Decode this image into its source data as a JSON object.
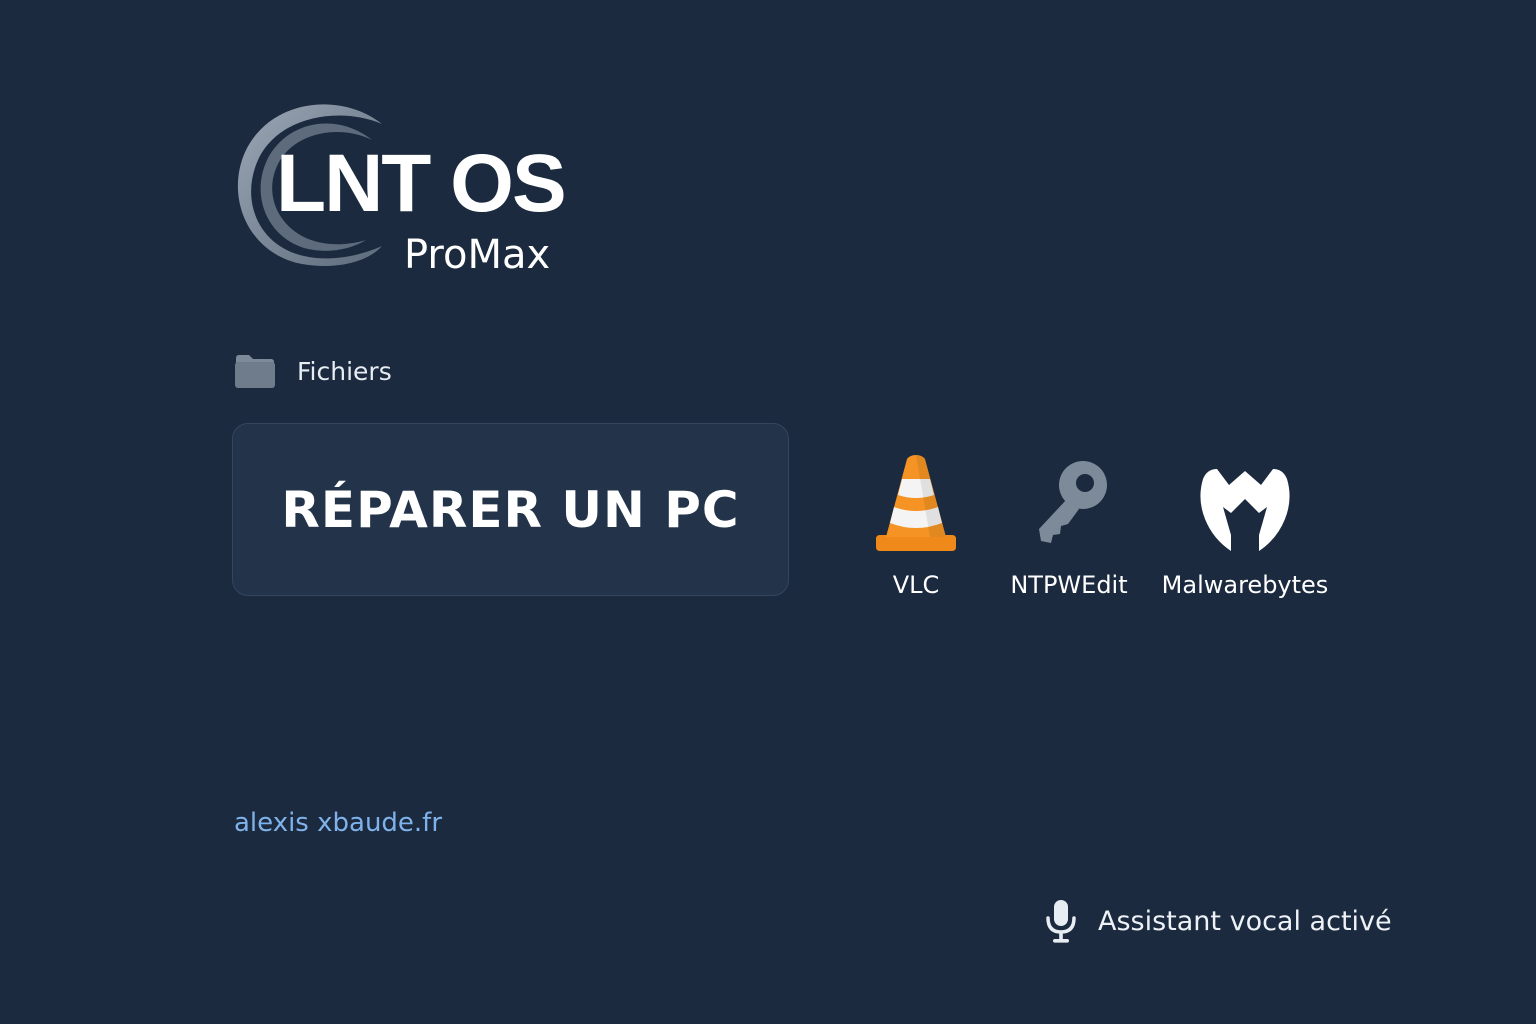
{
  "brand": {
    "name": "LNT OS",
    "edition": "ProMax"
  },
  "files": {
    "label": "Fichiers",
    "icon": "folder-icon"
  },
  "primary_action": {
    "label": "RÉPARER UN PC"
  },
  "apps": [
    {
      "label": "VLC",
      "icon": "vlc-cone-icon"
    },
    {
      "label": "NTPWEdit",
      "icon": "key-icon"
    },
    {
      "label": "Malwarebytes",
      "icon": "malwarebytes-icon"
    }
  ],
  "footer": {
    "website": "alexis xbaude.fr",
    "voice_status": "Assistant vocal activé",
    "voice_icon": "microphone-icon"
  },
  "colors": {
    "background": "#1b2a3e",
    "button": "#233349",
    "link": "#7fb2ea",
    "vlc_orange": "#f28b1c",
    "icon_gray": "#7d8a99"
  }
}
